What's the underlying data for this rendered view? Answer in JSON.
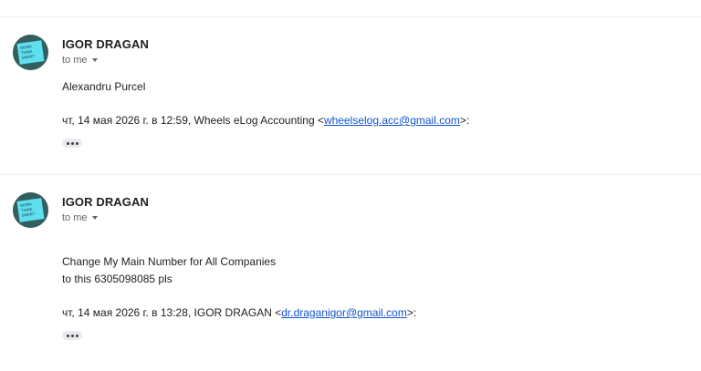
{
  "messages": [
    {
      "sender": "IGOR DRAGAN",
      "recipient": "to me",
      "body_lines": [
        "Alexandru Purcel"
      ],
      "quote_prefix": "чт, 14 мая 2026 г. в 12:59, Wheels eLog Accounting <",
      "quote_email": "wheelselog.acc@gmail.com",
      "quote_suffix": ">:",
      "avatar_text": [
        "WORK",
        "THINK",
        "SMART"
      ]
    },
    {
      "sender": "IGOR DRAGAN",
      "recipient": "to me",
      "body_lines": [
        "Change My Main Number for All Companies",
        "to this 6305098085 pls"
      ],
      "quote_prefix": "чт, 14 мая 2026 г. в 13:28, IGOR DRAGAN <",
      "quote_email": "dr.draganigor@gmail.com",
      "quote_suffix": ">:",
      "avatar_text": [
        "WORK",
        "THINK",
        "SMART"
      ]
    }
  ],
  "colors": {
    "link": "#1155cc",
    "avatar_bg": "#2f6a73",
    "avatar_note": "#5fe0ef"
  },
  "icons": {
    "recipient_caret": "caret-down-icon",
    "trimmed_content": "more-horiz-icon"
  }
}
